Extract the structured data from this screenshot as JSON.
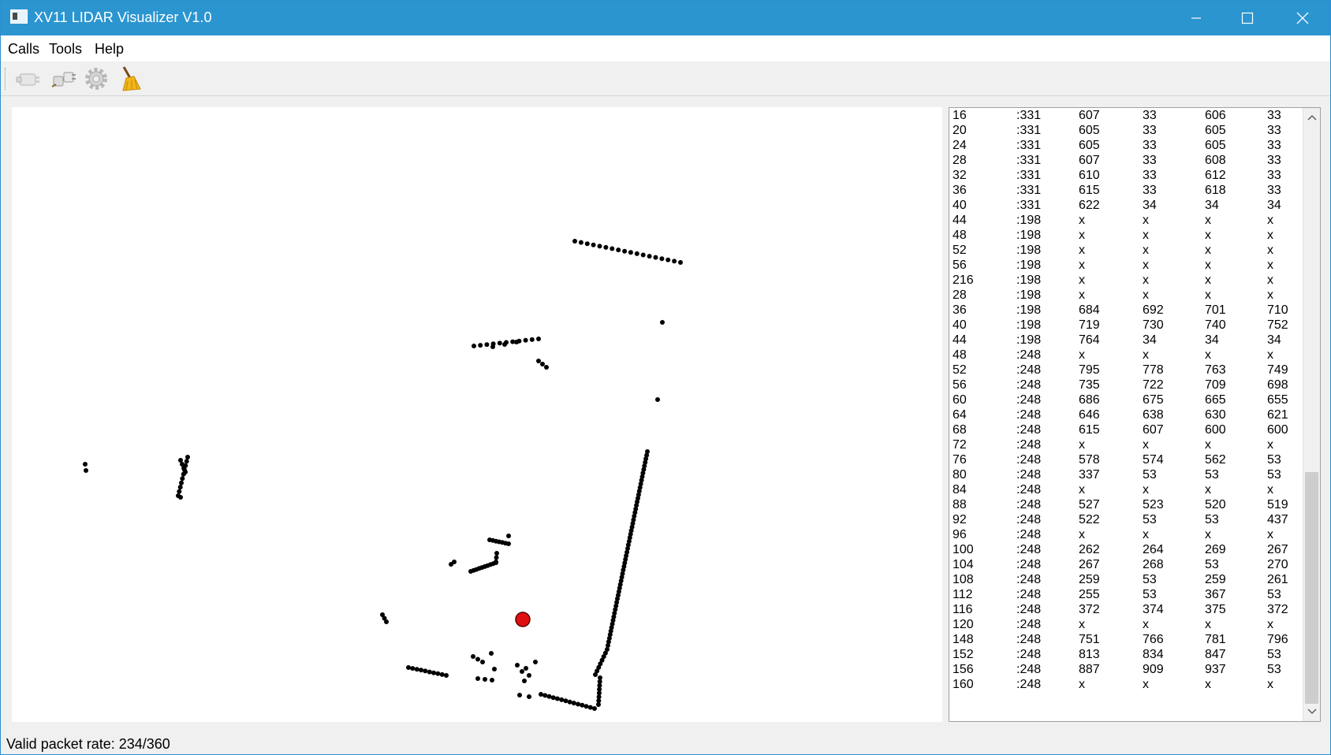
{
  "window": {
    "title": "XV11 LIDAR Visualizer V1.0"
  },
  "menu": {
    "items": [
      "Calls",
      "Tools",
      "Help"
    ]
  },
  "toolbar": {
    "buttons": [
      "connect-icon",
      "disconnect-icon",
      "settings-gear-icon",
      "clear-broom-icon"
    ]
  },
  "colors": {
    "titlebar": "#2b95d0",
    "robot_marker": "#e01010",
    "points": "#000000"
  },
  "table": {
    "rows": [
      [
        "16",
        ":331",
        "607",
        "33",
        "606",
        "33"
      ],
      [
        "20",
        ":331",
        "605",
        "33",
        "605",
        "33"
      ],
      [
        "24",
        ":331",
        "605",
        "33",
        "605",
        "33"
      ],
      [
        "28",
        ":331",
        "607",
        "33",
        "608",
        "33"
      ],
      [
        "32",
        ":331",
        "610",
        "33",
        "612",
        "33"
      ],
      [
        "36",
        ":331",
        "615",
        "33",
        "618",
        "33"
      ],
      [
        "40",
        ":331",
        "622",
        "34",
        "34",
        "34"
      ],
      [
        "44",
        ":198",
        "x",
        "x",
        "x",
        "x"
      ],
      [
        "48",
        ":198",
        "x",
        "x",
        "x",
        "x"
      ],
      [
        "52",
        ":198",
        "x",
        "x",
        "x",
        "x"
      ],
      [
        "56",
        ":198",
        "x",
        "x",
        "x",
        "x"
      ],
      [
        "216",
        ":198",
        "x",
        "x",
        "x",
        "x"
      ],
      [
        "28",
        ":198",
        "x",
        "x",
        "x",
        "x"
      ],
      [
        "36",
        ":198",
        "684",
        "692",
        "701",
        "710"
      ],
      [
        "40",
        ":198",
        "719",
        "730",
        "740",
        "752"
      ],
      [
        "44",
        ":198",
        "764",
        "34",
        "34",
        "34"
      ],
      [
        "48",
        ":248",
        "x",
        "x",
        "x",
        "x"
      ],
      [
        "52",
        ":248",
        "795",
        "778",
        "763",
        "749"
      ],
      [
        "56",
        ":248",
        "735",
        "722",
        "709",
        "698"
      ],
      [
        "60",
        ":248",
        "686",
        "675",
        "665",
        "655"
      ],
      [
        "64",
        ":248",
        "646",
        "638",
        "630",
        "621"
      ],
      [
        "68",
        ":248",
        "615",
        "607",
        "600",
        "600"
      ],
      [
        "72",
        ":248",
        "x",
        "x",
        "x",
        "x"
      ],
      [
        "76",
        ":248",
        "578",
        "574",
        "562",
        "53"
      ],
      [
        "80",
        ":248",
        "337",
        "53",
        "53",
        "53"
      ],
      [
        "84",
        ":248",
        "x",
        "x",
        "x",
        "x"
      ],
      [
        "88",
        ":248",
        "527",
        "523",
        "520",
        "519"
      ],
      [
        "92",
        ":248",
        "522",
        "53",
        "53",
        "437"
      ],
      [
        "96",
        ":248",
        "x",
        "x",
        "x",
        "x"
      ],
      [
        "100",
        ":248",
        "262",
        "264",
        "269",
        "267"
      ],
      [
        "104",
        ":248",
        "267",
        "268",
        "53",
        "270"
      ],
      [
        "108",
        ":248",
        "259",
        "53",
        "259",
        "261"
      ],
      [
        "112",
        ":248",
        "255",
        "53",
        "367",
        "53"
      ],
      [
        "116",
        ":248",
        "372",
        "374",
        "375",
        "372"
      ],
      [
        "120",
        ":248",
        "x",
        "x",
        "x",
        "x"
      ],
      [
        "148",
        ":248",
        "751",
        "766",
        "781",
        "796"
      ],
      [
        "152",
        ":248",
        "813",
        "834",
        "847",
        "53"
      ],
      [
        "156",
        ":248",
        "887",
        "909",
        "937",
        "53"
      ],
      [
        "160",
        ":248",
        "x",
        "x",
        "x",
        "x"
      ]
    ]
  },
  "status": {
    "text": "Valid packet rate: 234/360"
  }
}
